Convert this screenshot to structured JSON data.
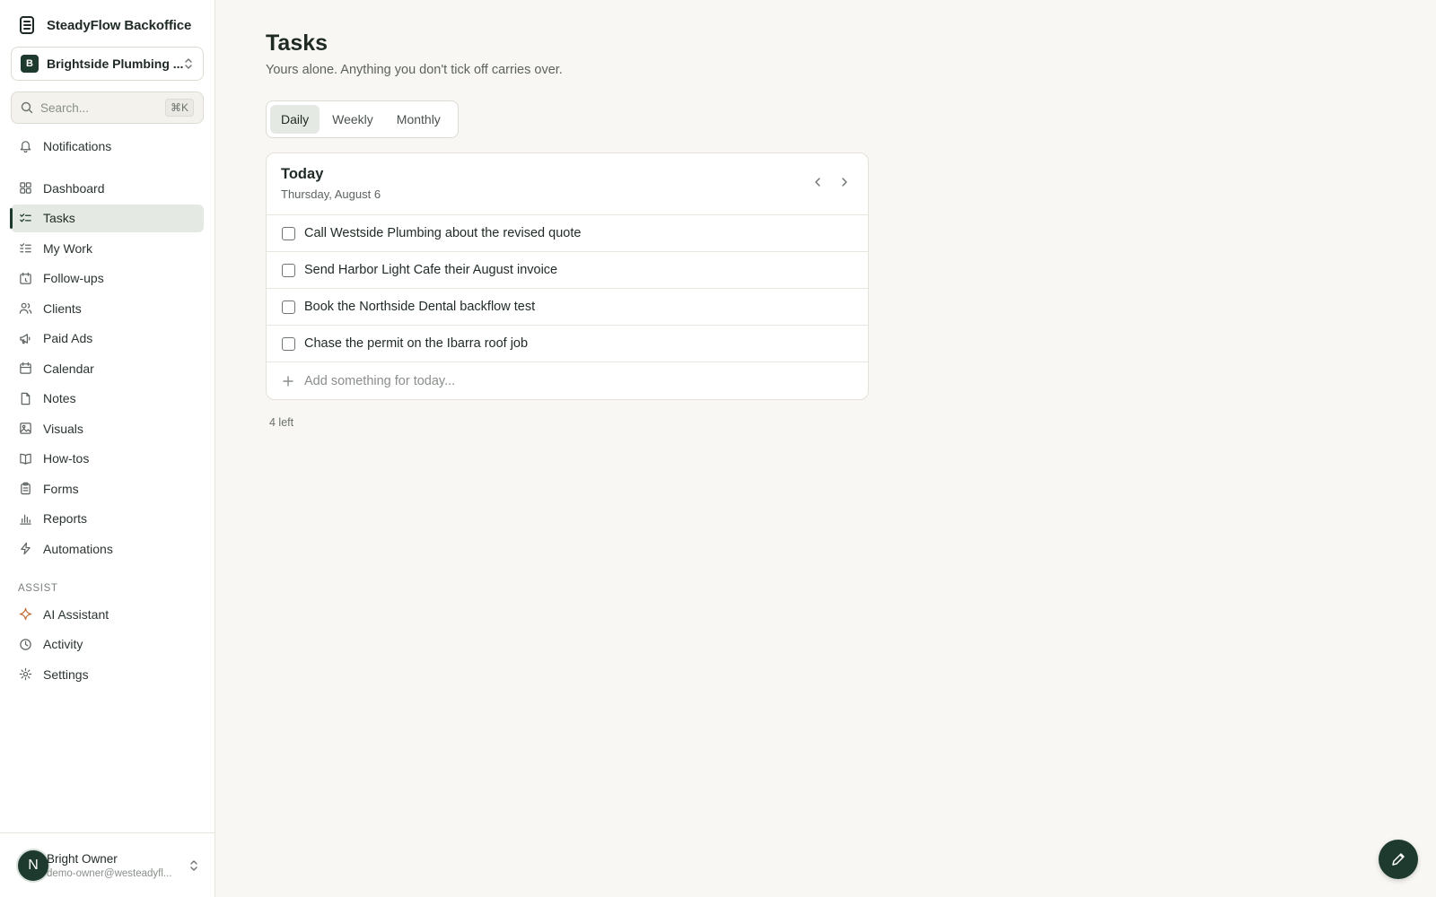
{
  "app": {
    "name": "SteadyFlow Backoffice"
  },
  "workspace": {
    "badge": "B",
    "name": "Brightside Plumbing ..."
  },
  "search": {
    "placeholder": "Search...",
    "shortcut": "⌘K"
  },
  "sidebar": {
    "notifications": "Notifications",
    "items": [
      {
        "label": "Dashboard",
        "icon": "dashboard-icon"
      },
      {
        "label": "Tasks",
        "icon": "tasks-icon",
        "active": true
      },
      {
        "label": "My Work",
        "icon": "my-work-icon"
      },
      {
        "label": "Follow-ups",
        "icon": "follow-ups-icon"
      },
      {
        "label": "Clients",
        "icon": "clients-icon"
      },
      {
        "label": "Paid Ads",
        "icon": "megaphone-icon"
      },
      {
        "label": "Calendar",
        "icon": "calendar-icon"
      },
      {
        "label": "Notes",
        "icon": "notes-icon"
      },
      {
        "label": "Visuals",
        "icon": "image-icon"
      },
      {
        "label": "How-tos",
        "icon": "book-icon"
      },
      {
        "label": "Forms",
        "icon": "clipboard-icon"
      },
      {
        "label": "Reports",
        "icon": "bar-chart-icon"
      },
      {
        "label": "Automations",
        "icon": "lightning-icon"
      }
    ],
    "section_label": "ASSIST",
    "assist_items": [
      {
        "label": "AI Assistant",
        "icon": "sparkle-icon"
      },
      {
        "label": "Activity",
        "icon": "clock-icon"
      },
      {
        "label": "Settings",
        "icon": "gear-icon"
      }
    ]
  },
  "user": {
    "initial": "N",
    "name": "Bright Owner",
    "email": "demo-owner@westeadyfl..."
  },
  "main": {
    "title": "Tasks",
    "subtitle": "Yours alone. Anything you don't tick off carries over.",
    "tabs": [
      {
        "label": "Daily",
        "active": true
      },
      {
        "label": "Weekly"
      },
      {
        "label": "Monthly"
      }
    ],
    "card": {
      "title": "Today",
      "date": "Thursday, August 6",
      "tasks": [
        "Call Westside Plumbing about the revised quote",
        "Send Harbor Light Cafe their August invoice",
        "Book the Northside Dental backflow test",
        "Chase the permit on the Ibarra roof job"
      ],
      "add_placeholder": "Add something for today..."
    },
    "remaining": "4 left"
  },
  "colors": {
    "accent": "#1e3a2f",
    "background": "#f8f7f3",
    "active_bg": "#e5e9e4",
    "sparkle": "#c2682f"
  }
}
